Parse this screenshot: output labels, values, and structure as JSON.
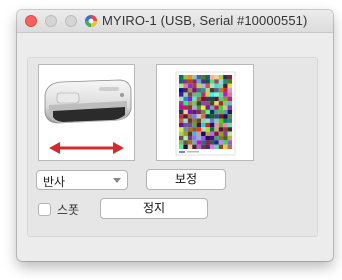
{
  "window": {
    "title": "MYIRO-1 (USB, Serial #10000551)"
  },
  "controls": {
    "mode_select_value": "반사",
    "calibrate_label": "보정",
    "spot_label": "스폿",
    "spot_checked": false,
    "stop_label": "정지"
  },
  "icons": {
    "app": "colorwheel-icon",
    "device": "spectrophotometer-device-image",
    "motion": "double-arrow-icon",
    "chart": "color-target-chart-image"
  },
  "colors": {
    "arrow": "#d42a2a",
    "close": "#fc615d"
  }
}
